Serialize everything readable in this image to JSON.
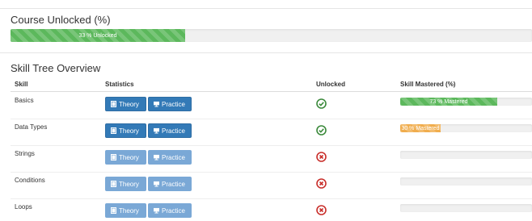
{
  "course": {
    "title": "Course Unlocked (%)",
    "progress_label": "33 % Unlocked",
    "progress_fraction": 0.33
  },
  "overview": {
    "title": "Skill Tree Overview",
    "columns": {
      "skill": "Skill",
      "statistics": "Statistics",
      "unlocked": "Unlocked",
      "mastered": "Skill Mastered (%)"
    }
  },
  "buttons": {
    "theory": "Theory",
    "practice": "Practice"
  },
  "rows": [
    {
      "skill": "Basics",
      "unlocked": true,
      "mastered_label": "73 % Mastered",
      "mastered_fraction": 0.73,
      "color": "green"
    },
    {
      "skill": "Data Types",
      "unlocked": true,
      "mastered_label": "30 % Mastered",
      "mastered_fraction": 0.3,
      "color": "orange"
    },
    {
      "skill": "Strings",
      "unlocked": false,
      "mastered_label": "",
      "mastered_fraction": 0
    },
    {
      "skill": "Conditions",
      "unlocked": false,
      "mastered_label": "",
      "mastered_fraction": 0
    },
    {
      "skill": "Loops",
      "unlocked": false,
      "mastered_label": "",
      "mastered_fraction": 0
    }
  ],
  "colors": {
    "primary": "#337ab7",
    "success": "#5cb85c",
    "warning": "#f0ad4e",
    "danger": "#c9302c"
  },
  "icons": {
    "theory": "book-icon",
    "practice": "practice-icon",
    "unlocked": "check-circle-icon",
    "locked": "x-circle-icon"
  }
}
